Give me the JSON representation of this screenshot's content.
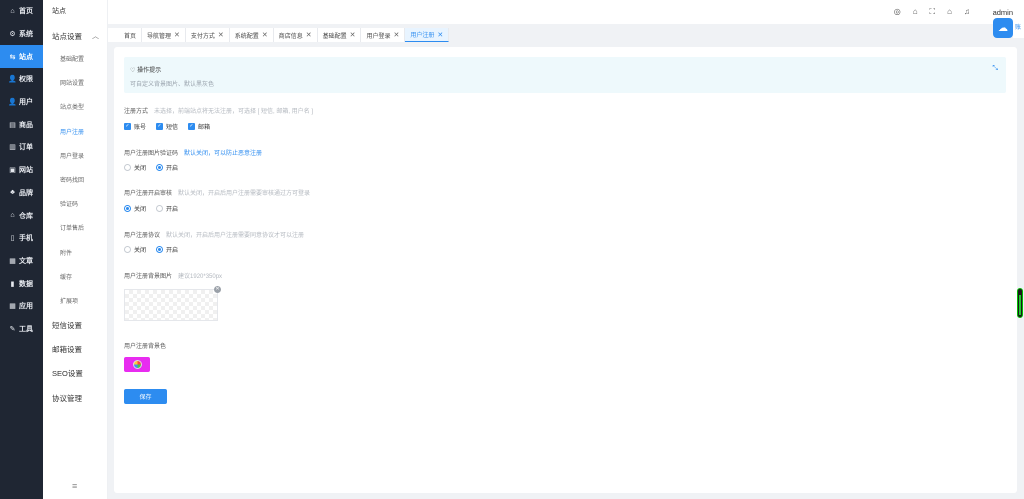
{
  "primary_nav": [
    {
      "icon": "home-icon",
      "glyph": "⌂",
      "label": "首页",
      "active": false
    },
    {
      "icon": "gear-icon",
      "glyph": "⚙",
      "label": "系统",
      "active": false
    },
    {
      "icon": "site-icon",
      "glyph": "⇆",
      "label": "站点",
      "active": true
    },
    {
      "icon": "permission-icon",
      "glyph": "👤",
      "label": "权限",
      "active": false
    },
    {
      "icon": "user-icon",
      "glyph": "👤",
      "label": "用户",
      "active": false
    },
    {
      "icon": "goods-icon",
      "glyph": "▤",
      "label": "商品",
      "active": false
    },
    {
      "icon": "order-icon",
      "glyph": "▥",
      "label": "订单",
      "active": false
    },
    {
      "icon": "website-icon",
      "glyph": "▣",
      "label": "网站",
      "active": false
    },
    {
      "icon": "brand-icon",
      "glyph": "♣",
      "label": "品牌",
      "active": false
    },
    {
      "icon": "warehouse-icon",
      "glyph": "⌂",
      "label": "仓库",
      "active": false
    },
    {
      "icon": "phone-icon",
      "glyph": "▯",
      "label": "手机",
      "active": false
    },
    {
      "icon": "article-icon",
      "glyph": "▦",
      "label": "文章",
      "active": false
    },
    {
      "icon": "data-icon",
      "glyph": "▮",
      "label": "数据",
      "active": false
    },
    {
      "icon": "apps-icon",
      "glyph": "▦",
      "label": "应用",
      "active": false
    },
    {
      "icon": "tools-icon",
      "glyph": "✎",
      "label": "工具",
      "active": false
    }
  ],
  "secondary_nav": {
    "title": "站点",
    "group_label": "站点设置",
    "items": [
      {
        "label": "基础配置",
        "active": false
      },
      {
        "label": "网站设置",
        "active": false
      },
      {
        "label": "站点类型",
        "active": false
      },
      {
        "label": "用户注册",
        "active": true
      },
      {
        "label": "用户登录",
        "active": false
      },
      {
        "label": "密码找回",
        "active": false
      },
      {
        "label": "验证码",
        "active": false
      },
      {
        "label": "订单售后",
        "active": false
      },
      {
        "label": "附件",
        "active": false
      },
      {
        "label": "缓存",
        "active": false
      },
      {
        "label": "扩展项",
        "active": false
      }
    ],
    "groups": [
      "短信设置",
      "邮箱设置",
      "SEO设置",
      "协议管理"
    ],
    "collapse_icon": "≡"
  },
  "topbar": {
    "icons": [
      "palette-icon",
      "building-icon",
      "fullscreen-icon",
      "home-icon",
      "bell-icon"
    ],
    "username": "admin",
    "app_badge_glyph": "☁",
    "app_badge_edge": "账"
  },
  "tabs": [
    {
      "label": "首页",
      "closable": false,
      "active": false
    },
    {
      "label": "导航管理",
      "closable": true,
      "active": false
    },
    {
      "label": "支付方式",
      "closable": true,
      "active": false
    },
    {
      "label": "系统配置",
      "closable": true,
      "active": false
    },
    {
      "label": "商店信息",
      "closable": true,
      "active": false
    },
    {
      "label": "基础配置",
      "closable": true,
      "active": false
    },
    {
      "label": "用户登录",
      "closable": true,
      "active": false
    },
    {
      "label": "用户注册",
      "closable": true,
      "active": true
    }
  ],
  "tips": {
    "title": "操作提示",
    "title_icon": "♡",
    "text": "可自定义背景图片、默认黑灰色",
    "shrink_icon": "⤡"
  },
  "form": {
    "register_method": {
      "label": "注册方式",
      "hint": "未选择，前端站点将无法注册，可选择 [ 短信, 邮箱, 用户名 ]",
      "options": [
        {
          "label": "账号",
          "checked": true
        },
        {
          "label": "短信",
          "checked": true
        },
        {
          "label": "邮箱",
          "checked": true
        }
      ]
    },
    "image_captcha": {
      "label": "用户注册图片验证码",
      "hint": "默认关闭，可以防止恶意注册",
      "options": [
        {
          "label": "关闭",
          "selected": false
        },
        {
          "label": "开启",
          "selected": true
        }
      ]
    },
    "review": {
      "label": "用户注册开启审核",
      "hint": "默认关闭，开启后用户注册需要审核通过方可登录",
      "options": [
        {
          "label": "关闭",
          "selected": true
        },
        {
          "label": "开启",
          "selected": false
        }
      ]
    },
    "agreement": {
      "label": "用户注册协议",
      "hint": "默认关闭，开启后用户注册需要同意协议才可以注册",
      "options": [
        {
          "label": "关闭",
          "selected": false
        },
        {
          "label": "开启",
          "selected": true
        }
      ]
    },
    "background_image": {
      "label": "用户注册背景图片",
      "hint": "建议1920*350px"
    },
    "background_color": {
      "label": "用户注册背景色",
      "value": "#e82cf0"
    },
    "save_label": "保存"
  }
}
